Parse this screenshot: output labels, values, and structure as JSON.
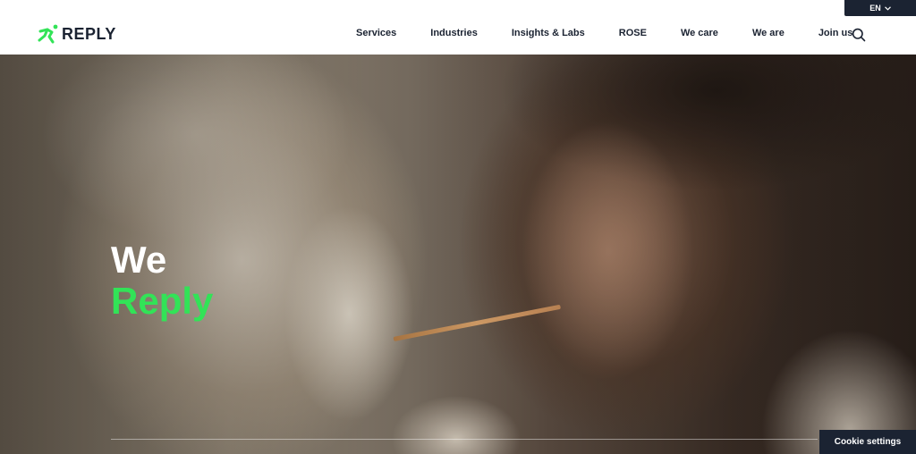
{
  "language": {
    "current": "EN"
  },
  "header": {
    "logo_text": "REPLY",
    "nav": [
      {
        "label": "Services"
      },
      {
        "label": "Industries"
      },
      {
        "label": "Insights & Labs"
      },
      {
        "label": "ROSE"
      },
      {
        "label": "We care"
      },
      {
        "label": "We are"
      },
      {
        "label": "Join us"
      }
    ]
  },
  "hero": {
    "line1": "We",
    "line2": "Reply"
  },
  "cookie": {
    "label": "Cookie settings"
  },
  "colors": {
    "accent_green": "#32e357",
    "navy": "#1b2332"
  },
  "icons": {
    "logo": "running-figure-icon",
    "search": "search-icon",
    "language": "chevron-down-icon"
  }
}
